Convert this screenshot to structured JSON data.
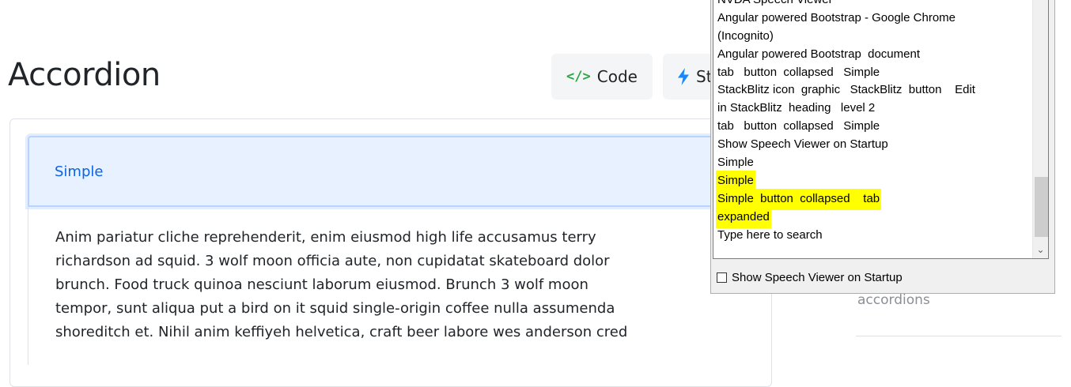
{
  "page": {
    "title": "Accordion",
    "code_button": {
      "icon_text": "</>",
      "label": "Code"
    },
    "stackblitz_button": {
      "label": "St"
    }
  },
  "accordion": {
    "header_label": "Simple",
    "body_lines": [
      "Anim pariatur cliche reprehenderit, enim eiusmod high life accusamus terry",
      "richardson ad squid. 3 wolf moon officia aute, non cupidatat skateboard dolor",
      "brunch. Food truck quinoa nesciunt laborum eiusmod. Brunch 3 wolf moon",
      "tempor, sunt aliqua put a bird on it squid single-origin coffee nulla assumenda",
      "shoreditch et. Nihil anim keffiyeh helvetica, craft beer labore wes anderson cred"
    ]
  },
  "sidebar": {
    "text": "accordions"
  },
  "nvda_viewer": {
    "lines": [
      "NVDA Speech Viewer",
      "Angular powered Bootstrap - Google Chrome",
      "(Incognito)",
      "Angular powered Bootstrap  document",
      "tab   button  collapsed   Simple",
      "StackBlitz icon  graphic   StackBlitz  button    Edit",
      "in StackBlitz  heading   level 2",
      "tab   button  collapsed   Simple",
      "Show Speech Viewer on Startup",
      "Simple",
      "Simple",
      "Simple  button  collapsed    tab",
      "expanded",
      "Type here to search"
    ],
    "highlighted_lines": [
      10,
      11,
      12
    ],
    "checkbox_label": "Show Speech Viewer on Startup",
    "checkbox_checked": false,
    "highlight_color": "#ffff00"
  },
  "colors": {
    "accent": "#0c63e4",
    "header_bg": "#e7f1ff",
    "code_icon": "#28a745"
  },
  "icons": {
    "code": "code-icon",
    "stackblitz": "lightning-bolt-icon",
    "scroll_down": "chevron-down-icon"
  }
}
